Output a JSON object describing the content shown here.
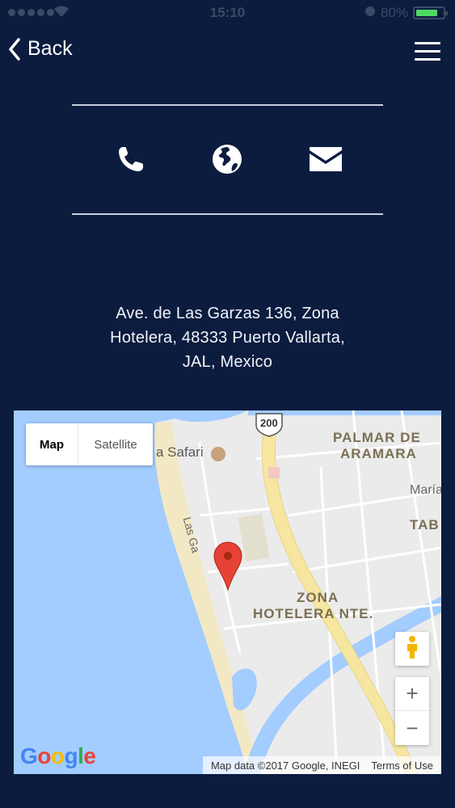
{
  "status_bar": {
    "time": "15:10",
    "battery_text": "80%",
    "battery_level": 0.8,
    "battery_color": "#4cd964"
  },
  "nav": {
    "back_label": "Back",
    "back_icon": "chevron-left-icon",
    "menu_icon": "hamburger-icon"
  },
  "contact_icons": [
    "phone-icon",
    "globe-icon",
    "email-icon"
  ],
  "address": {
    "line1": "Ave. de Las Garzas 136, Zona",
    "line2": "Hotelera, 48333 Puerto Vallarta,",
    "line3": "JAL, Mexico"
  },
  "map": {
    "type_map": "Map",
    "type_satellite": "Satellite",
    "labels": {
      "safari": "a Safari",
      "highway": "200",
      "palmar1": "PALMAR DE",
      "palmar2": "ARAMARA",
      "maria": "María",
      "tab": "TAB",
      "garzas": "Las Ga",
      "zona1": "ZONA",
      "zona2": "HOTELERA NTE."
    },
    "zoom_in": "+",
    "zoom_out": "−",
    "logo": "Google",
    "attribution": "Map data ©2017 Google, INEGI",
    "terms": "Terms of Use"
  },
  "colors": {
    "background": "#0b1c3f",
    "water": "#a3ccff",
    "beach": "#f2e8c4",
    "road": "#f6e6a0",
    "pin": "#e64235"
  }
}
